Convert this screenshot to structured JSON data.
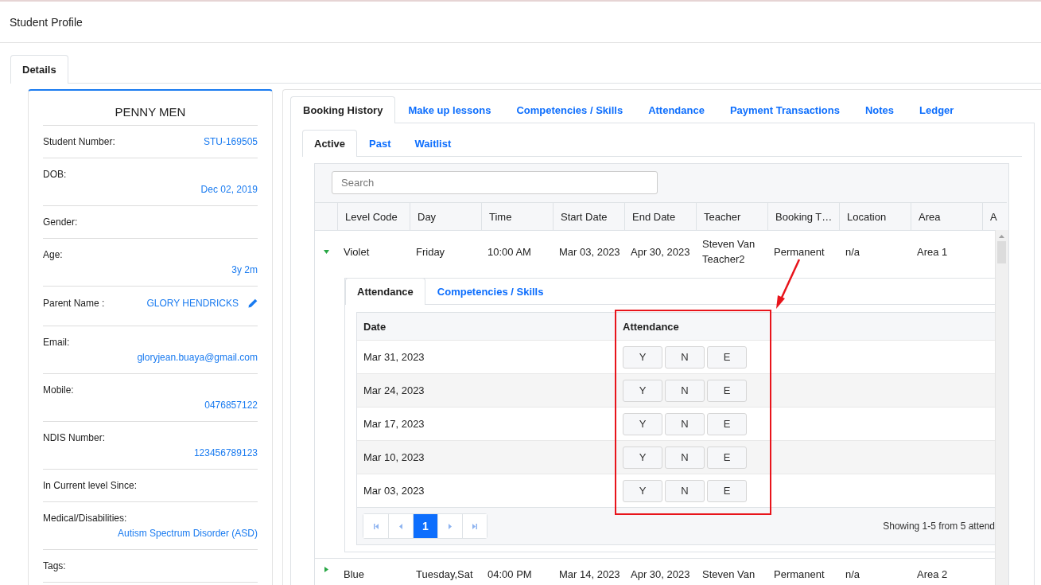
{
  "page_title": "Student Profile",
  "page_tabs": [
    {
      "label": "Details",
      "selected": true
    }
  ],
  "profile": {
    "name": "PENNY MEN",
    "fields": [
      {
        "label": "Student Number:",
        "value": "STU-169505",
        "kind": "inline"
      },
      {
        "label": "DOB:",
        "value": "Dec 02, 2019",
        "kind": "stacked"
      },
      {
        "label": "Gender:",
        "kind": "stacked"
      },
      {
        "label": "Age:",
        "value": "3y 2m",
        "kind": "stacked"
      },
      {
        "label": "Parent Name :",
        "value": "GLORY HENDRICKS",
        "kind": "editable"
      },
      {
        "label": "Email:",
        "value": "gloryjean.buaya@gmail.com",
        "kind": "stacked"
      },
      {
        "label": "Mobile:",
        "value": "0476857122",
        "kind": "stacked"
      },
      {
        "label": "NDIS Number:",
        "value": "123456789123",
        "kind": "stacked"
      },
      {
        "label": "In Current level Since:",
        "kind": "stacked"
      },
      {
        "label": "Medical/Disabilities:",
        "value": "Autism Spectrum Disorder (ASD)",
        "kind": "stacked"
      },
      {
        "label": "Tags:",
        "kind": "stacked"
      }
    ]
  },
  "main_tabs": [
    {
      "label": "Booking History",
      "selected": true
    },
    {
      "label": "Make up lessons",
      "selected": false
    },
    {
      "label": "Competencies / Skills",
      "selected": false
    },
    {
      "label": "Attendance",
      "selected": false
    },
    {
      "label": "Payment Transactions",
      "selected": false
    },
    {
      "label": "Notes",
      "selected": false
    },
    {
      "label": "Ledger",
      "selected": false
    }
  ],
  "booking_tabs": [
    {
      "label": "Active",
      "selected": true
    },
    {
      "label": "Past",
      "selected": false
    },
    {
      "label": "Waitlist",
      "selected": false
    }
  ],
  "search": {
    "placeholder": "Search"
  },
  "table": {
    "columns": [
      "Level Code",
      "Day",
      "Time",
      "Start Date",
      "End Date",
      "Teacher",
      "Booking T…",
      "Location",
      "Area",
      "A"
    ],
    "rows": [
      {
        "expanded": true,
        "cells": [
          "Violet",
          "Friday",
          "10:00 AM",
          "Mar 03, 2023",
          "Apr 30, 2023",
          "Steven Van Teacher2",
          "Permanent",
          "n/a",
          "Area 1"
        ],
        "detail": {
          "tabs": [
            {
              "label": "Attendance",
              "selected": true
            },
            {
              "label": "Competencies / Skills",
              "selected": false
            }
          ],
          "columns": [
            "Date",
            "Attendance"
          ],
          "rows": [
            {
              "date": "Mar 31, 2023",
              "options": [
                "Y",
                "N",
                "E"
              ]
            },
            {
              "date": "Mar 24, 2023",
              "options": [
                "Y",
                "N",
                "E"
              ]
            },
            {
              "date": "Mar 17, 2023",
              "options": [
                "Y",
                "N",
                "E"
              ]
            },
            {
              "date": "Mar 10, 2023",
              "options": [
                "Y",
                "N",
                "E"
              ]
            },
            {
              "date": "Mar 03, 2023",
              "options": [
                "Y",
                "N",
                "E"
              ]
            }
          ],
          "pages": [
            {
              "label": "1",
              "selected": true
            }
          ],
          "summary": "Showing 1-5 from 5 attend"
        }
      },
      {
        "expanded": false,
        "cells": [
          "Blue",
          "Tuesday,Sat",
          "04:00 PM",
          "Mar 14, 2023",
          "Apr 30, 2023",
          "Steven Van",
          "Permanent",
          "n/a",
          "Area 2"
        ]
      }
    ]
  }
}
